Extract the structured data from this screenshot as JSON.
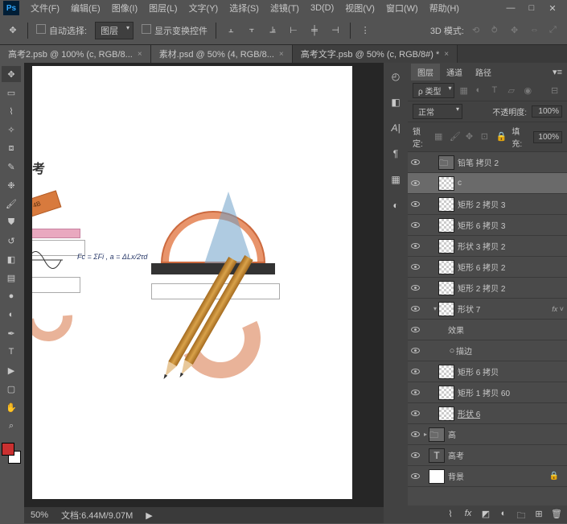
{
  "app": {
    "logo": "Ps"
  },
  "menubar": [
    "文件(F)",
    "编辑(E)",
    "图像(I)",
    "图层(L)",
    "文字(Y)",
    "选择(S)",
    "滤镜(T)",
    "3D(D)",
    "视图(V)",
    "窗口(W)",
    "帮助(H)"
  ],
  "win": {
    "min": "—",
    "max": "□",
    "close": "✕"
  },
  "options": {
    "auto_select": "自动选择:",
    "auto_select_value": "图层",
    "show_transform": "显示变换控件",
    "mode3d_label": "3D 模式:"
  },
  "tabs": [
    {
      "label": "高考2.psb @ 100% (c, RGB/8...",
      "close": "×",
      "active": false
    },
    {
      "label": "素材.psd @ 50% (4, RGB/8...",
      "close": "×",
      "active": false
    },
    {
      "label": "高考文字.psb @ 50% (c, RGB/8#) *",
      "close": "×",
      "active": true
    }
  ],
  "status": {
    "zoom": "50%",
    "docsize": "文档:6.44M/9.07M",
    "arrow": "▶"
  },
  "panel": {
    "tabs": [
      "图层",
      "通道",
      "路径"
    ],
    "kind_label": "ρ 类型",
    "blend_mode": "正常",
    "opacity_label": "不透明度:",
    "opacity_value": "100%",
    "lock_label": "锁定:",
    "fill_label": "填充:",
    "fill_value": "100%"
  },
  "layers": [
    {
      "vis": true,
      "indent": 1,
      "arrow": "",
      "thumb": "folder",
      "name": "铅笔 拷贝 2",
      "selected": false
    },
    {
      "vis": true,
      "indent": 1,
      "arrow": "",
      "thumb": "checker",
      "name": "c",
      "selected": true
    },
    {
      "vis": true,
      "indent": 1,
      "arrow": "",
      "thumb": "checker",
      "name": "矩形 2 拷贝 3",
      "selected": false
    },
    {
      "vis": true,
      "indent": 1,
      "arrow": "",
      "thumb": "checker",
      "name": "矩形 6 拷贝 3",
      "selected": false
    },
    {
      "vis": true,
      "indent": 1,
      "arrow": "",
      "thumb": "checker",
      "name": "形状 3 拷贝 2",
      "selected": false
    },
    {
      "vis": true,
      "indent": 1,
      "arrow": "",
      "thumb": "checker",
      "name": "矩形 6 拷贝 2",
      "selected": false
    },
    {
      "vis": true,
      "indent": 1,
      "arrow": "",
      "thumb": "checker",
      "name": "矩形 2 拷贝 2",
      "selected": false
    },
    {
      "vis": true,
      "indent": 1,
      "arrow": "▾",
      "thumb": "checker",
      "name": "形状 7",
      "selected": false,
      "fx": "fx"
    },
    {
      "vis": true,
      "indent": 2,
      "arrow": "",
      "thumb": "none",
      "name": "效果",
      "selected": false
    },
    {
      "vis": true,
      "indent": 2,
      "arrow": "",
      "thumb": "none",
      "name": "描边",
      "selected": false,
      "bullet": "○"
    },
    {
      "vis": true,
      "indent": 1,
      "arrow": "",
      "thumb": "checker",
      "name": "矩形 6 拷贝",
      "selected": false
    },
    {
      "vis": true,
      "indent": 1,
      "arrow": "",
      "thumb": "checker",
      "name": "矩形 1 拷贝 60",
      "selected": false
    },
    {
      "vis": true,
      "indent": 1,
      "arrow": "",
      "thumb": "checker",
      "name": "形状 6",
      "selected": false,
      "underline": true
    },
    {
      "vis": true,
      "indent": 0,
      "arrow": "▸",
      "thumb": "folder",
      "name": "高",
      "selected": false
    },
    {
      "vis": true,
      "indent": 0,
      "arrow": "",
      "thumb": "text",
      "name": "高考",
      "selected": false
    },
    {
      "vis": true,
      "indent": 0,
      "arrow": "",
      "thumb": "solid",
      "name": "背景",
      "selected": false,
      "locked": true
    }
  ],
  "canvas_text": {
    "kao": "考",
    "eraser": "4B",
    "formula": "Fc = ΣFi ,  a = ΔLx/2τd"
  },
  "colors": {
    "fg": "#c93030",
    "bg": "#ffffff"
  }
}
